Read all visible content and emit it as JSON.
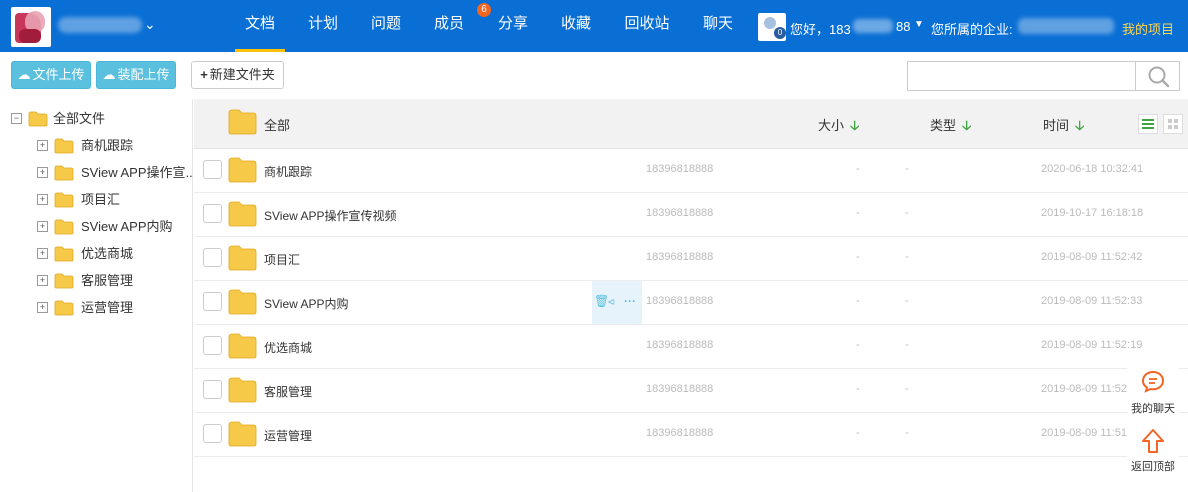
{
  "nav": {
    "items": [
      {
        "label": "文档",
        "active": true
      },
      {
        "label": "计划"
      },
      {
        "label": "问题"
      },
      {
        "label": "成员",
        "badge": "6"
      },
      {
        "label": "分享"
      },
      {
        "label": "收藏"
      },
      {
        "label": "回收站"
      },
      {
        "label": "聊天"
      }
    ],
    "avatar_badge": "0",
    "greeting": "您好，183",
    "phone_suffix": "88",
    "company_label": "您所属的企业:",
    "my_project": "我的项目"
  },
  "toolbar": {
    "upload_file": "文件上传",
    "upload_assembly": "装配上传",
    "new_folder": "新建文件夹",
    "search_placeholder": ""
  },
  "tree": {
    "root": "全部文件",
    "items": [
      "商机跟踪",
      "SView APP操作宣...",
      "项目汇",
      "SView APP内购",
      "优选商城",
      "客服管理",
      "运营管理"
    ]
  },
  "list": {
    "header": {
      "all": "全部",
      "size": "大小",
      "type": "类型",
      "time": "时间"
    },
    "rows": [
      {
        "name": "商机跟踪",
        "owner": "18396818888",
        "size": "-",
        "type": "-",
        "time": "2020-06-18 10:32:41"
      },
      {
        "name": "SView APP操作宣传视频",
        "owner": "18396818888",
        "size": "-",
        "type": "-",
        "time": "2019-10-17 16:18:18"
      },
      {
        "name": "项目汇",
        "owner": "18396818888",
        "size": "-",
        "type": "-",
        "time": "2019-08-09 11:52:42"
      },
      {
        "name": "SView APP内购",
        "owner": "18396818888",
        "size": "-",
        "type": "-",
        "time": "2019-08-09 11:52:33"
      },
      {
        "name": "优选商城",
        "owner": "18396818888",
        "size": "-",
        "type": "-",
        "time": "2019-08-09 11:52:19"
      },
      {
        "name": "客服管理",
        "owner": "18396818888",
        "size": "-",
        "type": "-",
        "time": "2019-08-09 11:52"
      },
      {
        "name": "运营管理",
        "owner": "18396818888",
        "size": "-",
        "type": "-",
        "time": "2019-08-09 11:51"
      }
    ]
  },
  "floating": {
    "chat": "我的聊天",
    "back_top": "返回顶部"
  },
  "colors": {
    "nav_bg": "#0a6fd4",
    "accent_yellow": "#ffc107",
    "teal_button": "#5bc0de",
    "folder": "#f7c948",
    "sort_arrow": "#3fa33f"
  },
  "icons": {
    "upload": "cloud-upload-icon",
    "new_folder": "plus-icon",
    "search": "search-icon",
    "folder": "folder-icon",
    "delete": "trash-icon",
    "share": "share-icon",
    "more": "more-icon",
    "chat": "chat-icon",
    "top": "arrow-up-icon",
    "list_view": "list-view-icon",
    "grid_view": "grid-view-icon"
  }
}
